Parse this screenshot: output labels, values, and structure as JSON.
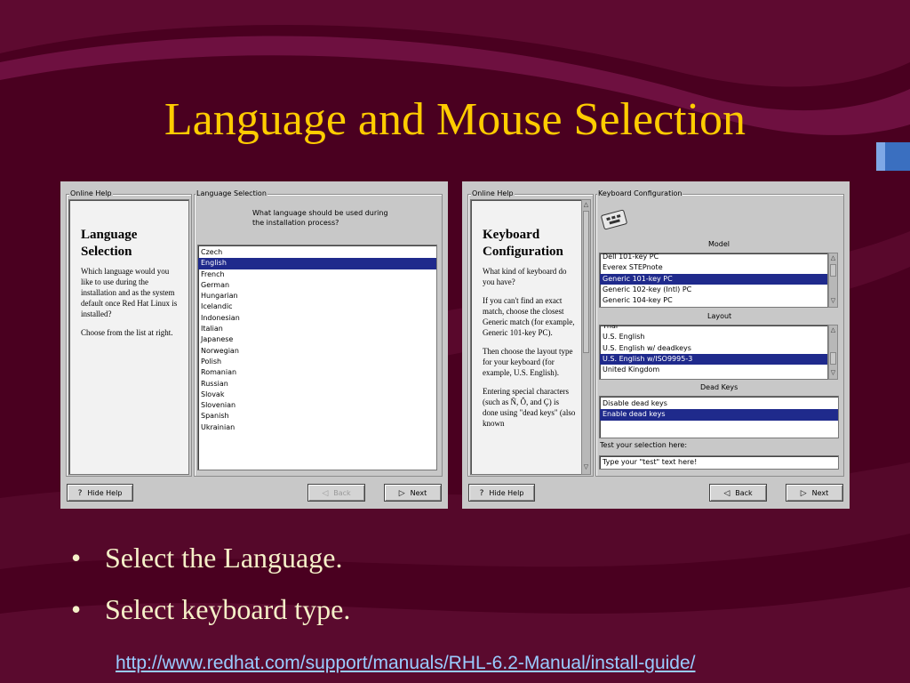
{
  "slide": {
    "title": "Language and Mouse Selection",
    "bullets": [
      "Select the Language.",
      "Select keyboard type."
    ],
    "link": "http://www.redhat.com/support/manuals/RHL-6.2-Manual/install-guide/"
  },
  "colors": {
    "background": "#4a0020",
    "title": "#ffcc00",
    "bullet_text": "#f5f0c8",
    "link": "#99ccff",
    "selection": "#1f2a8c"
  },
  "screen1": {
    "online_help_label": "Online Help",
    "group_label": "Language Selection",
    "help_title": "Language Selection",
    "help_paragraphs": [
      "Which language would you like to use during the installation and as the system default once Red Hat Linux is installed?",
      "Choose from the list at right."
    ],
    "question": "What language should be used during the installation process?",
    "languages": [
      "Czech",
      "English",
      "French",
      "German",
      "Hungarian",
      "Icelandic",
      "Indonesian",
      "Italian",
      "Japanese",
      "Norwegian",
      "Polish",
      "Romanian",
      "Russian",
      "Slovak",
      "Slovenian",
      "Spanish",
      "Ukrainian"
    ],
    "selected_language": "English",
    "buttons": {
      "hide_help": "Hide Help",
      "back": "Back",
      "next": "Next"
    }
  },
  "screen2": {
    "online_help_label": "Online Help",
    "group_label": "Keyboard Configuration",
    "help_title": "Keyboard Configuration",
    "help_paragraphs": [
      "What kind of keyboard do you have?",
      "If you can't find an exact match, choose the closest Generic match (for example, Generic 101-key PC).",
      "Then choose the layout type for your keyboard (for example, U.S. English).",
      "Entering special characters (such as Ñ, Ô, and Ç) is done using \"dead keys\" (also known"
    ],
    "model_label": "Model",
    "models": [
      "Dell 101-key PC",
      "Everex STEPnote",
      "Generic 101-key PC",
      "Generic 102-key (Intl) PC",
      "Generic 104-key PC"
    ],
    "selected_model": "Generic 101-key PC",
    "layout_label": "Layout",
    "layouts": [
      "Thai",
      "U.S. English",
      "U.S. English w/ deadkeys",
      "U.S. English w/ISO9995-3",
      "United Kingdom"
    ],
    "selected_layout": "U.S. English w/ISO9995-3",
    "dead_keys_label": "Dead Keys",
    "dead_keys": [
      "Disable dead keys",
      "Enable dead keys"
    ],
    "selected_dead_keys": "Enable dead keys",
    "test_label": "Test your selection here:",
    "test_value": "Type your \"test\" text here!",
    "buttons": {
      "hide_help": "Hide Help",
      "back": "Back",
      "next": "Next"
    }
  }
}
